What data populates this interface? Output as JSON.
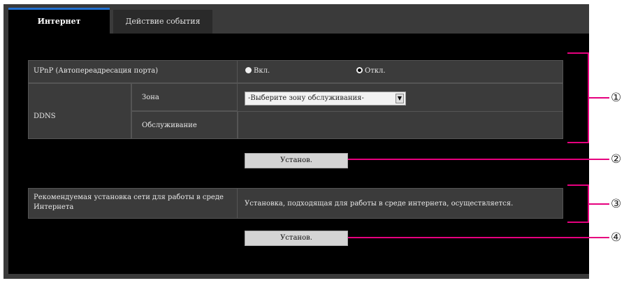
{
  "tabs": [
    "Интернет",
    "Действие события"
  ],
  "upnp": {
    "label": "UPnP (Автопереадресация порта)",
    "on": "Вкл.",
    "off": "Откл.",
    "selected": "off"
  },
  "ddns": {
    "label": "DDNS",
    "zone_label": "Зона",
    "service_label": "Обслуживание",
    "select_value": "-Выберите зону обслуживания-"
  },
  "buttons": {
    "set1": "Установ.",
    "set2": "Установ."
  },
  "recommend": {
    "label": "Рекомендуемая установка сети для работы в среде Интернета",
    "value": "Установка, подходящая для работы в среде интернета, осуществляется."
  },
  "callouts": [
    "①",
    "②",
    "③",
    "④"
  ],
  "colors": {
    "accent": "#e6007e",
    "tab_accent": "#1f6fd0"
  }
}
